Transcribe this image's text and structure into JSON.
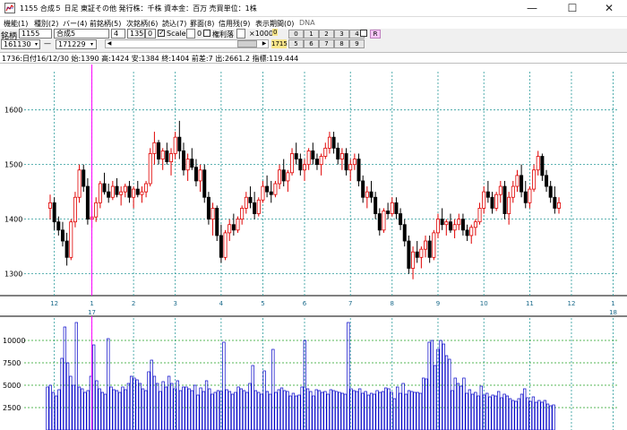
{
  "window": {
    "title": "1155 合成５  日足  東証その他  発行株：千株  資本金：百万  売買単位：1株",
    "min": "—",
    "max": "☐",
    "close": "✕"
  },
  "menu": [
    {
      "label": "機能(1)"
    },
    {
      "label": "種別(2)"
    },
    {
      "label": "バー(4)"
    },
    {
      "label": "前銘柄(5)"
    },
    {
      "label": "次銘柄(6)"
    },
    {
      "label": "読込(7)"
    },
    {
      "label": "罫面(8)"
    },
    {
      "label": "信用残(9)"
    },
    {
      "label": "表示期間(0)"
    },
    {
      "label": "DNA"
    }
  ],
  "toolbar": {
    "symbol_label": "銘柄",
    "symbol_value": "1155",
    "name_value": "合成5",
    "field_a": "4",
    "field_b": "1350",
    "field_c": "0",
    "scale_label": "Scale",
    "scale_checked": "✓",
    "box_zero": "0",
    "margin_label": "権利落",
    "times_label": "×1000",
    "top_zero": "0",
    "from_value": "161130",
    "dash": "—",
    "to_value": "171229",
    "tag": "1715",
    "r_label": "R",
    "num_row1": [
      "0",
      "1",
      "2",
      "3",
      "4"
    ],
    "num_row2": [
      "5",
      "6",
      "7",
      "8",
      "9"
    ],
    "arrow_left": "◀",
    "arrow_right": "▶",
    "dropdown": "▾"
  },
  "info": {
    "text": "1736:日付16/12/30 始:1390 高:1424 安:1384 終:1404 前差:7 出:2661.2 指標:119.444"
  },
  "chart_data": [
    {
      "type": "candlestick",
      "y_ticks": [
        1300,
        1400,
        1500,
        1600
      ],
      "ylim": [
        1260,
        1670
      ],
      "x_ticks": [
        {
          "label": "12",
          "index": 1
        },
        {
          "label": "1",
          "index": 10
        },
        {
          "label": "2",
          "index": 20
        },
        {
          "label": "3",
          "index": 30
        },
        {
          "label": "4",
          "index": 41
        },
        {
          "label": "5",
          "index": 51
        },
        {
          "label": "6",
          "index": 61
        },
        {
          "label": "7",
          "index": 72
        },
        {
          "label": "8",
          "index": 82
        },
        {
          "label": "9",
          "index": 93
        },
        {
          "label": "10",
          "index": 104
        },
        {
          "label": "11",
          "index": 115
        },
        {
          "label": "12",
          "index": 125
        },
        {
          "label": "1",
          "index": 135
        }
      ],
      "year_labels": [
        {
          "label": "17",
          "index": 10
        },
        {
          "label": "18",
          "index": 135
        }
      ],
      "cursor_index": 10,
      "grid": true,
      "up_color": "#e00000",
      "down_color": "#000000",
      "candles": [
        [
          1420,
          1445,
          1400,
          1430
        ],
        [
          1430,
          1440,
          1380,
          1395
        ],
        [
          1395,
          1405,
          1370,
          1380
        ],
        [
          1380,
          1395,
          1350,
          1360
        ],
        [
          1360,
          1375,
          1315,
          1330
        ],
        [
          1330,
          1400,
          1325,
          1395
        ],
        [
          1395,
          1450,
          1385,
          1440
        ],
        [
          1440,
          1500,
          1430,
          1490
        ],
        [
          1490,
          1500,
          1450,
          1460
        ],
        [
          1460,
          1475,
          1390,
          1400
        ],
        [
          1400,
          1425,
          1384,
          1404
        ],
        [
          1404,
          1440,
          1395,
          1430
        ],
        [
          1430,
          1470,
          1420,
          1465
        ],
        [
          1465,
          1485,
          1445,
          1450
        ],
        [
          1450,
          1465,
          1430,
          1440
        ],
        [
          1440,
          1470,
          1435,
          1460
        ],
        [
          1460,
          1475,
          1440,
          1445
        ],
        [
          1445,
          1460,
          1425,
          1450
        ],
        [
          1450,
          1465,
          1440,
          1460
        ],
        [
          1460,
          1470,
          1430,
          1440
        ],
        [
          1440,
          1460,
          1420,
          1455
        ],
        [
          1455,
          1470,
          1440,
          1445
        ],
        [
          1445,
          1460,
          1430,
          1450
        ],
        [
          1450,
          1470,
          1440,
          1465
        ],
        [
          1465,
          1530,
          1460,
          1520
        ],
        [
          1520,
          1560,
          1500,
          1540
        ],
        [
          1540,
          1545,
          1500,
          1510
        ],
        [
          1510,
          1530,
          1490,
          1525
        ],
        [
          1525,
          1540,
          1500,
          1505
        ],
        [
          1505,
          1530,
          1480,
          1520
        ],
        [
          1520,
          1560,
          1510,
          1550
        ],
        [
          1550,
          1580,
          1510,
          1525
        ],
        [
          1525,
          1540,
          1480,
          1490
        ],
        [
          1490,
          1520,
          1470,
          1510
        ],
        [
          1510,
          1530,
          1490,
          1495
        ],
        [
          1495,
          1510,
          1460,
          1470
        ],
        [
          1470,
          1500,
          1450,
          1490
        ],
        [
          1490,
          1500,
          1430,
          1440
        ],
        [
          1440,
          1450,
          1390,
          1400
        ],
        [
          1400,
          1430,
          1370,
          1420
        ],
        [
          1420,
          1425,
          1360,
          1370
        ],
        [
          1370,
          1390,
          1320,
          1330
        ],
        [
          1330,
          1380,
          1325,
          1375
        ],
        [
          1375,
          1400,
          1360,
          1390
        ],
        [
          1390,
          1410,
          1370,
          1380
        ],
        [
          1380,
          1405,
          1375,
          1400
        ],
        [
          1400,
          1425,
          1390,
          1420
        ],
        [
          1420,
          1450,
          1410,
          1440
        ],
        [
          1440,
          1460,
          1420,
          1430
        ],
        [
          1430,
          1450,
          1400,
          1410
        ],
        [
          1410,
          1440,
          1405,
          1435
        ],
        [
          1435,
          1470,
          1430,
          1460
        ],
        [
          1460,
          1480,
          1440,
          1450
        ],
        [
          1450,
          1470,
          1430,
          1445
        ],
        [
          1445,
          1470,
          1440,
          1465
        ],
        [
          1465,
          1500,
          1455,
          1490
        ],
        [
          1490,
          1510,
          1460,
          1470
        ],
        [
          1470,
          1490,
          1450,
          1485
        ],
        [
          1485,
          1530,
          1480,
          1520
        ],
        [
          1520,
          1540,
          1500,
          1510
        ],
        [
          1510,
          1520,
          1480,
          1490
        ],
        [
          1490,
          1510,
          1470,
          1500
        ],
        [
          1500,
          1530,
          1490,
          1525
        ],
        [
          1525,
          1540,
          1500,
          1510
        ],
        [
          1510,
          1520,
          1490,
          1500
        ],
        [
          1500,
          1520,
          1480,
          1515
        ],
        [
          1515,
          1540,
          1510,
          1530
        ],
        [
          1530,
          1560,
          1520,
          1550
        ],
        [
          1550,
          1560,
          1520,
          1530
        ],
        [
          1530,
          1540,
          1500,
          1510
        ],
        [
          1510,
          1530,
          1490,
          1520
        ],
        [
          1520,
          1530,
          1480,
          1490
        ],
        [
          1490,
          1510,
          1470,
          1500
        ],
        [
          1500,
          1520,
          1490,
          1510
        ],
        [
          1510,
          1520,
          1460,
          1470
        ],
        [
          1470,
          1480,
          1430,
          1440
        ],
        [
          1440,
          1460,
          1420,
          1450
        ],
        [
          1450,
          1470,
          1430,
          1440
        ],
        [
          1440,
          1450,
          1400,
          1410
        ],
        [
          1410,
          1420,
          1370,
          1380
        ],
        [
          1380,
          1420,
          1375,
          1415
        ],
        [
          1415,
          1430,
          1400,
          1410
        ],
        [
          1410,
          1440,
          1405,
          1430
        ],
        [
          1430,
          1440,
          1400,
          1410
        ],
        [
          1410,
          1420,
          1380,
          1390
        ],
        [
          1390,
          1400,
          1350,
          1360
        ],
        [
          1360,
          1370,
          1300,
          1310
        ],
        [
          1310,
          1350,
          1290,
          1340
        ],
        [
          1340,
          1360,
          1320,
          1330
        ],
        [
          1330,
          1350,
          1310,
          1345
        ],
        [
          1345,
          1370,
          1330,
          1360
        ],
        [
          1360,
          1370,
          1320,
          1330
        ],
        [
          1330,
          1380,
          1325,
          1375
        ],
        [
          1375,
          1410,
          1365,
          1400
        ],
        [
          1400,
          1420,
          1380,
          1390
        ],
        [
          1390,
          1400,
          1370,
          1395
        ],
        [
          1395,
          1410,
          1375,
          1380
        ],
        [
          1380,
          1400,
          1365,
          1390
        ],
        [
          1390,
          1410,
          1380,
          1400
        ],
        [
          1400,
          1410,
          1370,
          1380
        ],
        [
          1380,
          1390,
          1360,
          1370
        ],
        [
          1370,
          1390,
          1355,
          1385
        ],
        [
          1385,
          1400,
          1370,
          1395
        ],
        [
          1395,
          1430,
          1390,
          1420
        ],
        [
          1420,
          1460,
          1410,
          1450
        ],
        [
          1450,
          1470,
          1430,
          1440
        ],
        [
          1440,
          1450,
          1410,
          1420
        ],
        [
          1420,
          1450,
          1415,
          1445
        ],
        [
          1445,
          1470,
          1430,
          1460
        ],
        [
          1460,
          1470,
          1400,
          1410
        ],
        [
          1410,
          1450,
          1390,
          1440
        ],
        [
          1440,
          1470,
          1430,
          1460
        ],
        [
          1460,
          1490,
          1450,
          1480
        ],
        [
          1480,
          1500,
          1440,
          1450
        ],
        [
          1450,
          1470,
          1420,
          1430
        ],
        [
          1430,
          1460,
          1420,
          1455
        ],
        [
          1455,
          1500,
          1450,
          1490
        ],
        [
          1490,
          1525,
          1480,
          1515
        ],
        [
          1515,
          1520,
          1470,
          1480
        ],
        [
          1480,
          1490,
          1450,
          1460
        ],
        [
          1460,
          1470,
          1430,
          1440
        ],
        [
          1440,
          1460,
          1410,
          1420
        ],
        [
          1420,
          1440,
          1410,
          1430
        ]
      ]
    },
    {
      "type": "bar",
      "y_ticks": [
        2500,
        5000,
        7500,
        10000
      ],
      "ylim": [
        0,
        12500
      ],
      "grid": true,
      "bar_color": "#0000c8",
      "values": [
        4800,
        5000,
        4200,
        3800,
        4500,
        8000,
        11500,
        7500,
        6000,
        5000,
        12000,
        4800,
        4600,
        4200,
        4400,
        6000,
        9500,
        5500,
        4600,
        4200,
        4000,
        10200,
        4800,
        4500,
        4400,
        4200,
        4800,
        4500,
        5200,
        6000,
        5800,
        5600,
        5200,
        4600,
        4400,
        6500,
        7800,
        6000,
        5200,
        4300,
        5400,
        4800,
        6000,
        5200,
        4600,
        5500,
        4400,
        4800,
        4800,
        4600,
        4400,
        5000,
        3900,
        4700,
        4300,
        5500,
        4600,
        4000,
        4200,
        4400,
        4300,
        9800,
        4500,
        4300,
        4000,
        4200,
        4800,
        4600,
        4400,
        4200,
        5200,
        7200,
        4400,
        4200,
        4000,
        6600,
        4300,
        4000,
        9000,
        4200,
        4500,
        4700,
        4400,
        4300,
        3800,
        4100,
        3800,
        3900,
        4800,
        10000,
        4600,
        4300,
        3800,
        4500,
        4400,
        4200,
        4300,
        4000,
        4500,
        4400,
        4300,
        4200,
        4100,
        4000,
        12000,
        4600,
        4400,
        4300,
        4600,
        4100,
        4300,
        3900,
        4100,
        4000,
        4400,
        4200,
        4300,
        4700,
        4600,
        4200,
        3500,
        4800,
        4100,
        5200,
        4000,
        4400,
        4300,
        4200,
        4200,
        4100,
        5800,
        5700,
        9800,
        10000,
        7200,
        9000,
        10000,
        9600,
        8300,
        7900,
        4400,
        5800,
        5200,
        4900,
        5800,
        4100,
        4500,
        4000,
        4200,
        3800,
        4900,
        3900,
        4100,
        3700,
        3900,
        3800,
        4300,
        3600,
        4000,
        3800,
        3500,
        3300,
        3200,
        3500,
        4000,
        4600,
        3600,
        3200,
        3700,
        3100,
        3300,
        3100,
        3300,
        2900,
        2700,
        2800
      ]
    }
  ]
}
